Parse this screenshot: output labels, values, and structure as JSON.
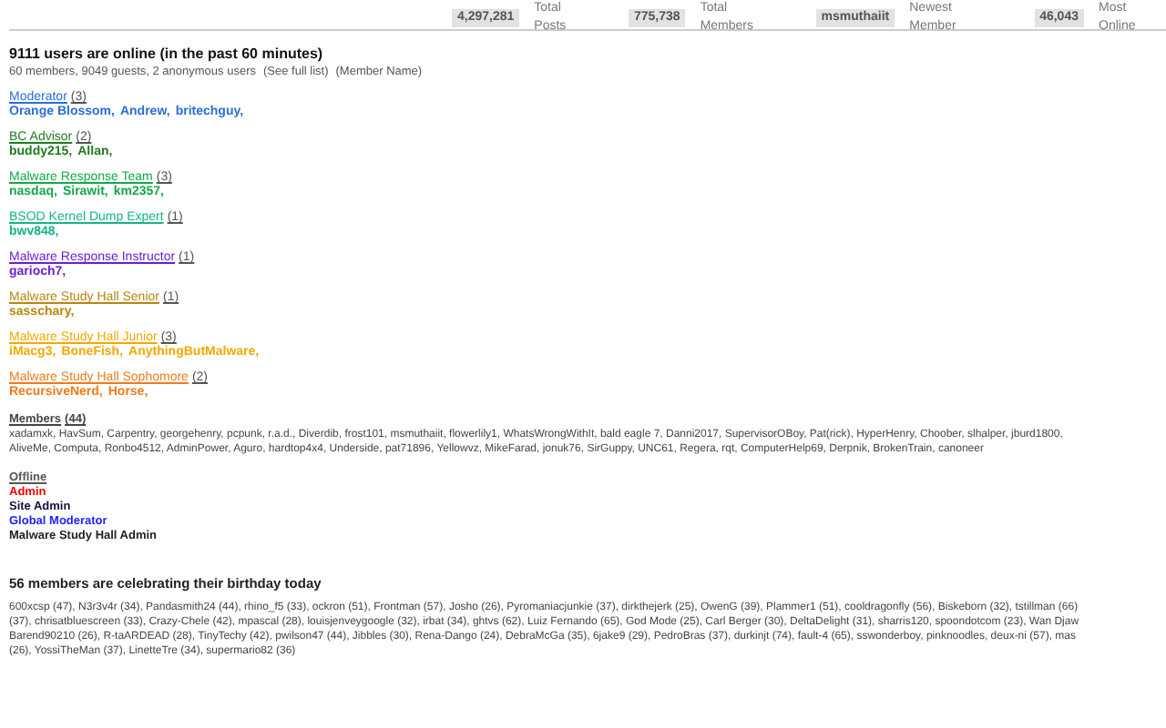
{
  "stats": [
    {
      "value": "4,297,281",
      "label": "Total Posts"
    },
    {
      "value": "775,738",
      "label": "Total Members"
    },
    {
      "value": "msmuthaiit",
      "label": "Newest Member"
    },
    {
      "value": "46,043",
      "label": "Most Online"
    }
  ],
  "online": {
    "title": "9111 users are online (in the past 60 minutes)",
    "summary": "60 members, 9049 guests, 2 anonymous users",
    "links": [
      "(See full list)",
      "(Member Name)"
    ]
  },
  "groups": [
    {
      "name": "Moderator",
      "count": "(3)",
      "color": "#2a6fd6",
      "members": [
        "Orange Blossom,",
        "Andrew,",
        "britechguy,"
      ]
    },
    {
      "name": "BC Advisor",
      "count": "(2)",
      "color": "#1e7d1e",
      "members": [
        "buddy215,",
        "Allan,"
      ]
    },
    {
      "name": "Malware Response Team",
      "count": "(3)",
      "color": "#14a84a",
      "members": [
        "nasdaq,",
        "Sirawit,",
        "km2357,"
      ]
    },
    {
      "name": "BSOD Kernel Dump Expert",
      "count": "(1)",
      "color": "#16b48a",
      "members": [
        "bwv848,"
      ]
    },
    {
      "name": "Malware Response Instructor",
      "count": "(1)",
      "color": "#6a1fd0",
      "members": [
        "garioch7,"
      ]
    },
    {
      "name": "Malware Study Hall Senior",
      "count": "(1)",
      "color": "#b8860b",
      "members": [
        "sasschary,"
      ]
    },
    {
      "name": "Malware Study Hall Junior",
      "count": "(3)",
      "color": "#f2a900",
      "members": [
        "iMacg3,",
        "BoneFish,",
        "AnythingButMalware,"
      ]
    },
    {
      "name": "Malware Study Hall Sophomore",
      "count": "(2)",
      "color": "#f27a1a",
      "members": [
        "RecursiveNerd,",
        "Horse,"
      ]
    }
  ],
  "members": {
    "name": "Members",
    "count": "(44)",
    "lines": [
      "xadamxk, HavSum, Carpentry, georgehenry, pcpunk, r.a.d., Diverdib, frost101, msmuthaiit, flowerlily1, WhatsWrongWithIt, bald eagle 7, Danni2017, SupervisorOBoy, Pat(rick), HyperHenry, Choober, slhalper, jburd1800,",
      "AliveMe, Computa, Ronbo4512, AdminPower, Aguro, hardtop4x4, Underside, pat71896, Yellowvz, MikeFarad, jonuk76, SirGuppy, UNC61, Regera, rqt, ComputerHelp69, Derpnik, BrokenTrain, canoneer"
    ]
  },
  "legend": [
    {
      "label": "Offline",
      "color": "#555555",
      "underline": true
    },
    {
      "label": "Admin",
      "color": "#ff0000",
      "underline": false
    },
    {
      "label": "Site Admin",
      "color": "#101040",
      "underline": false
    },
    {
      "label": "Global Moderator",
      "color": "#2222ff",
      "underline": false
    },
    {
      "label": "Malware Study Hall Admin",
      "color": "#222222",
      "underline": false
    }
  ],
  "birthdays": {
    "title": "56 members are celebrating their birthday today",
    "lines": [
      "600xcsp (47), N3r3v4r (34), Pandasmith24 (44), rhino_f5 (33), ockron (51), Frontman (57), Josho (26), Pyromaniacjunkie (37), dirkthejerk (25), OwenG (39), Plammer1 (51), cooldragonfly (56), Biskeborn (32), tstillman (66)",
      "(37), chrisatbluescreen (33), Crazy-Chele (42), mpascal (28), louisjenveygoogle (32), irbat (34), ghtvs (62), Luiz Fernando (65), God Mode (25), Carl Berger (30), DeltaDelight (31), sharris120, spoondotcom (23), Wan Djaw",
      "Barend90210 (26), R-taARDEAD (28), TinyTechy (42), pwilson47 (44), Jibbles (30), Rena-Dango (24), DebraMcGa (35), 6jake9 (29), PedroBras (37), durkinjt (74), fault-4 (65), sswonderboy, pinknoodles, deux-ni (57), mas",
      "(26), YossiTheMan (37), LinetteTre (34), supermario82 (36)"
    ]
  }
}
